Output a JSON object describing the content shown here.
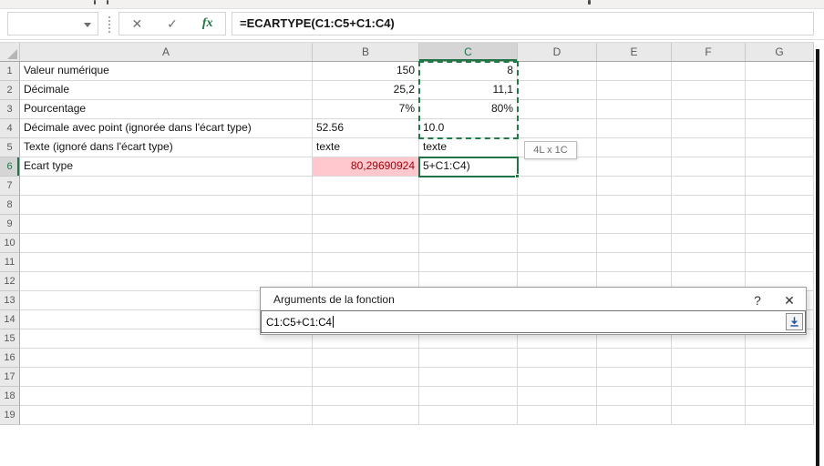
{
  "formula_bar": {
    "name_box_value": "",
    "cancel_glyph": "✕",
    "enter_glyph": "✓",
    "fx_glyph": "fx",
    "formula": "=ECARTYPE(C1:C5+C1:C4)"
  },
  "sheet": {
    "column_headers": [
      "A",
      "B",
      "C",
      "D",
      "E",
      "F",
      "G"
    ],
    "row_count": 19,
    "selected_column": "C",
    "selected_row": 6,
    "marquee_range": "C1:C4",
    "active_cell": "C6",
    "tooltip": "4L x 1C",
    "rows": [
      {
        "A": "Valeur numérique",
        "B": "150",
        "C": "8",
        "B_align": "right",
        "C_align": "right"
      },
      {
        "A": "Décimale",
        "B": "25,2",
        "C": "11,1",
        "B_align": "right",
        "C_align": "right"
      },
      {
        "A": "Pourcentage",
        "B": "7%",
        "C": "80%",
        "B_align": "right",
        "C_align": "right"
      },
      {
        "A": "Décimale avec point  (ignorée dans l'écart type)",
        "B": "52.56",
        "C": "10.0",
        "B_align": "left",
        "C_align": "left"
      },
      {
        "A": "Texte (ignoré dans l'écart type)",
        "B": "texte",
        "C": "texte",
        "B_align": "left",
        "C_align": "left"
      },
      {
        "A": "Ecart type",
        "B": "80,29690924",
        "C": "5+C1:C4)",
        "B_align": "right",
        "C_align": "left",
        "B_class": "bad",
        "C_class": "editing"
      }
    ]
  },
  "dialog": {
    "title": "Arguments de la fonction",
    "help_glyph": "?",
    "close_glyph": "✕",
    "input_value": "C1:C5+C1:C4"
  },
  "colors": {
    "accent_green": "#217346",
    "marquee_green": "#1E7B46",
    "bad_cell_bg": "#FFC7CE",
    "bad_cell_text": "#9C0006"
  }
}
